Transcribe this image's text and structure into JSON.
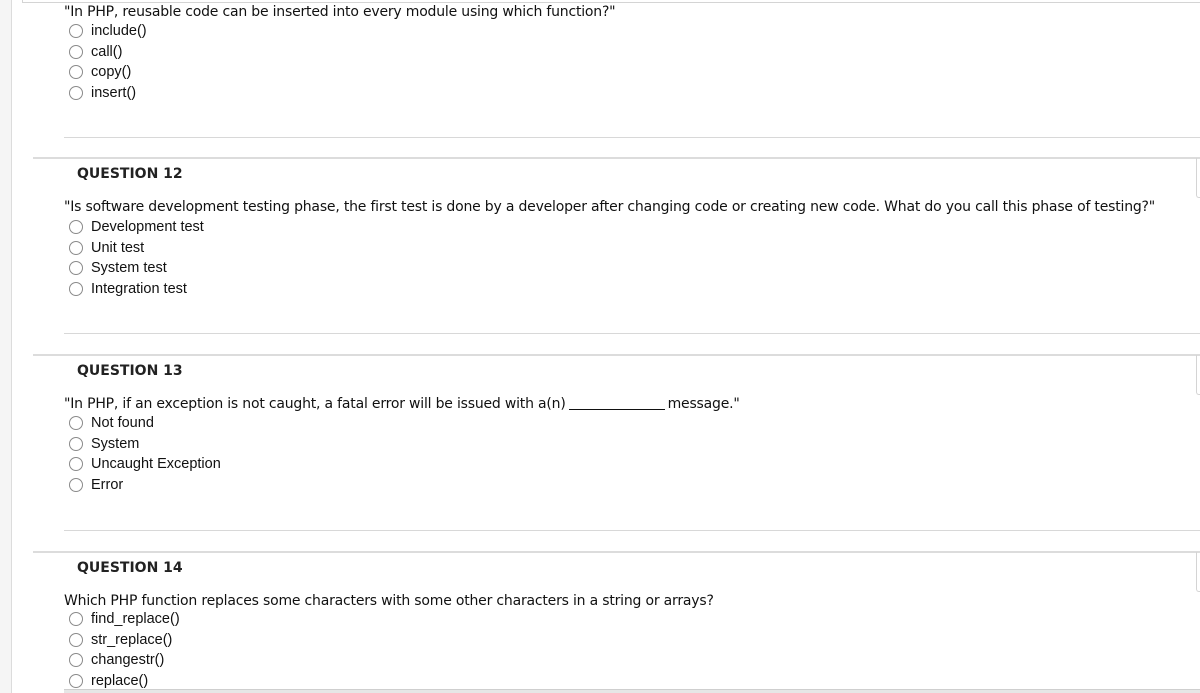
{
  "questions": [
    {
      "heading": "",
      "prompt": "\"In PHP, reusable code can be inserted into every module using which function?\"",
      "options": [
        "include()",
        "call()",
        "copy()",
        "insert()"
      ]
    },
    {
      "heading": "QUESTION 12",
      "prompt": "\"Is software development testing phase, the first test is done by a developer after changing code or creating new code. What do you call this phase of testing?\"",
      "options": [
        "Development test",
        "Unit test",
        "System test",
        "Integration test"
      ]
    },
    {
      "heading": "QUESTION 13",
      "prompt_before": "\"In PHP, if an exception is not caught, a fatal error will be issued with a(n)",
      "prompt_after": "message.\"",
      "options": [
        "Not found",
        "System",
        "Uncaught Exception",
        "Error"
      ]
    },
    {
      "heading": "QUESTION 14",
      "prompt": "Which PHP function replaces some characters with some other characters in a string or arrays?",
      "options": [
        "find_replace()",
        "str_replace()",
        "changestr()",
        "replace()"
      ]
    }
  ]
}
